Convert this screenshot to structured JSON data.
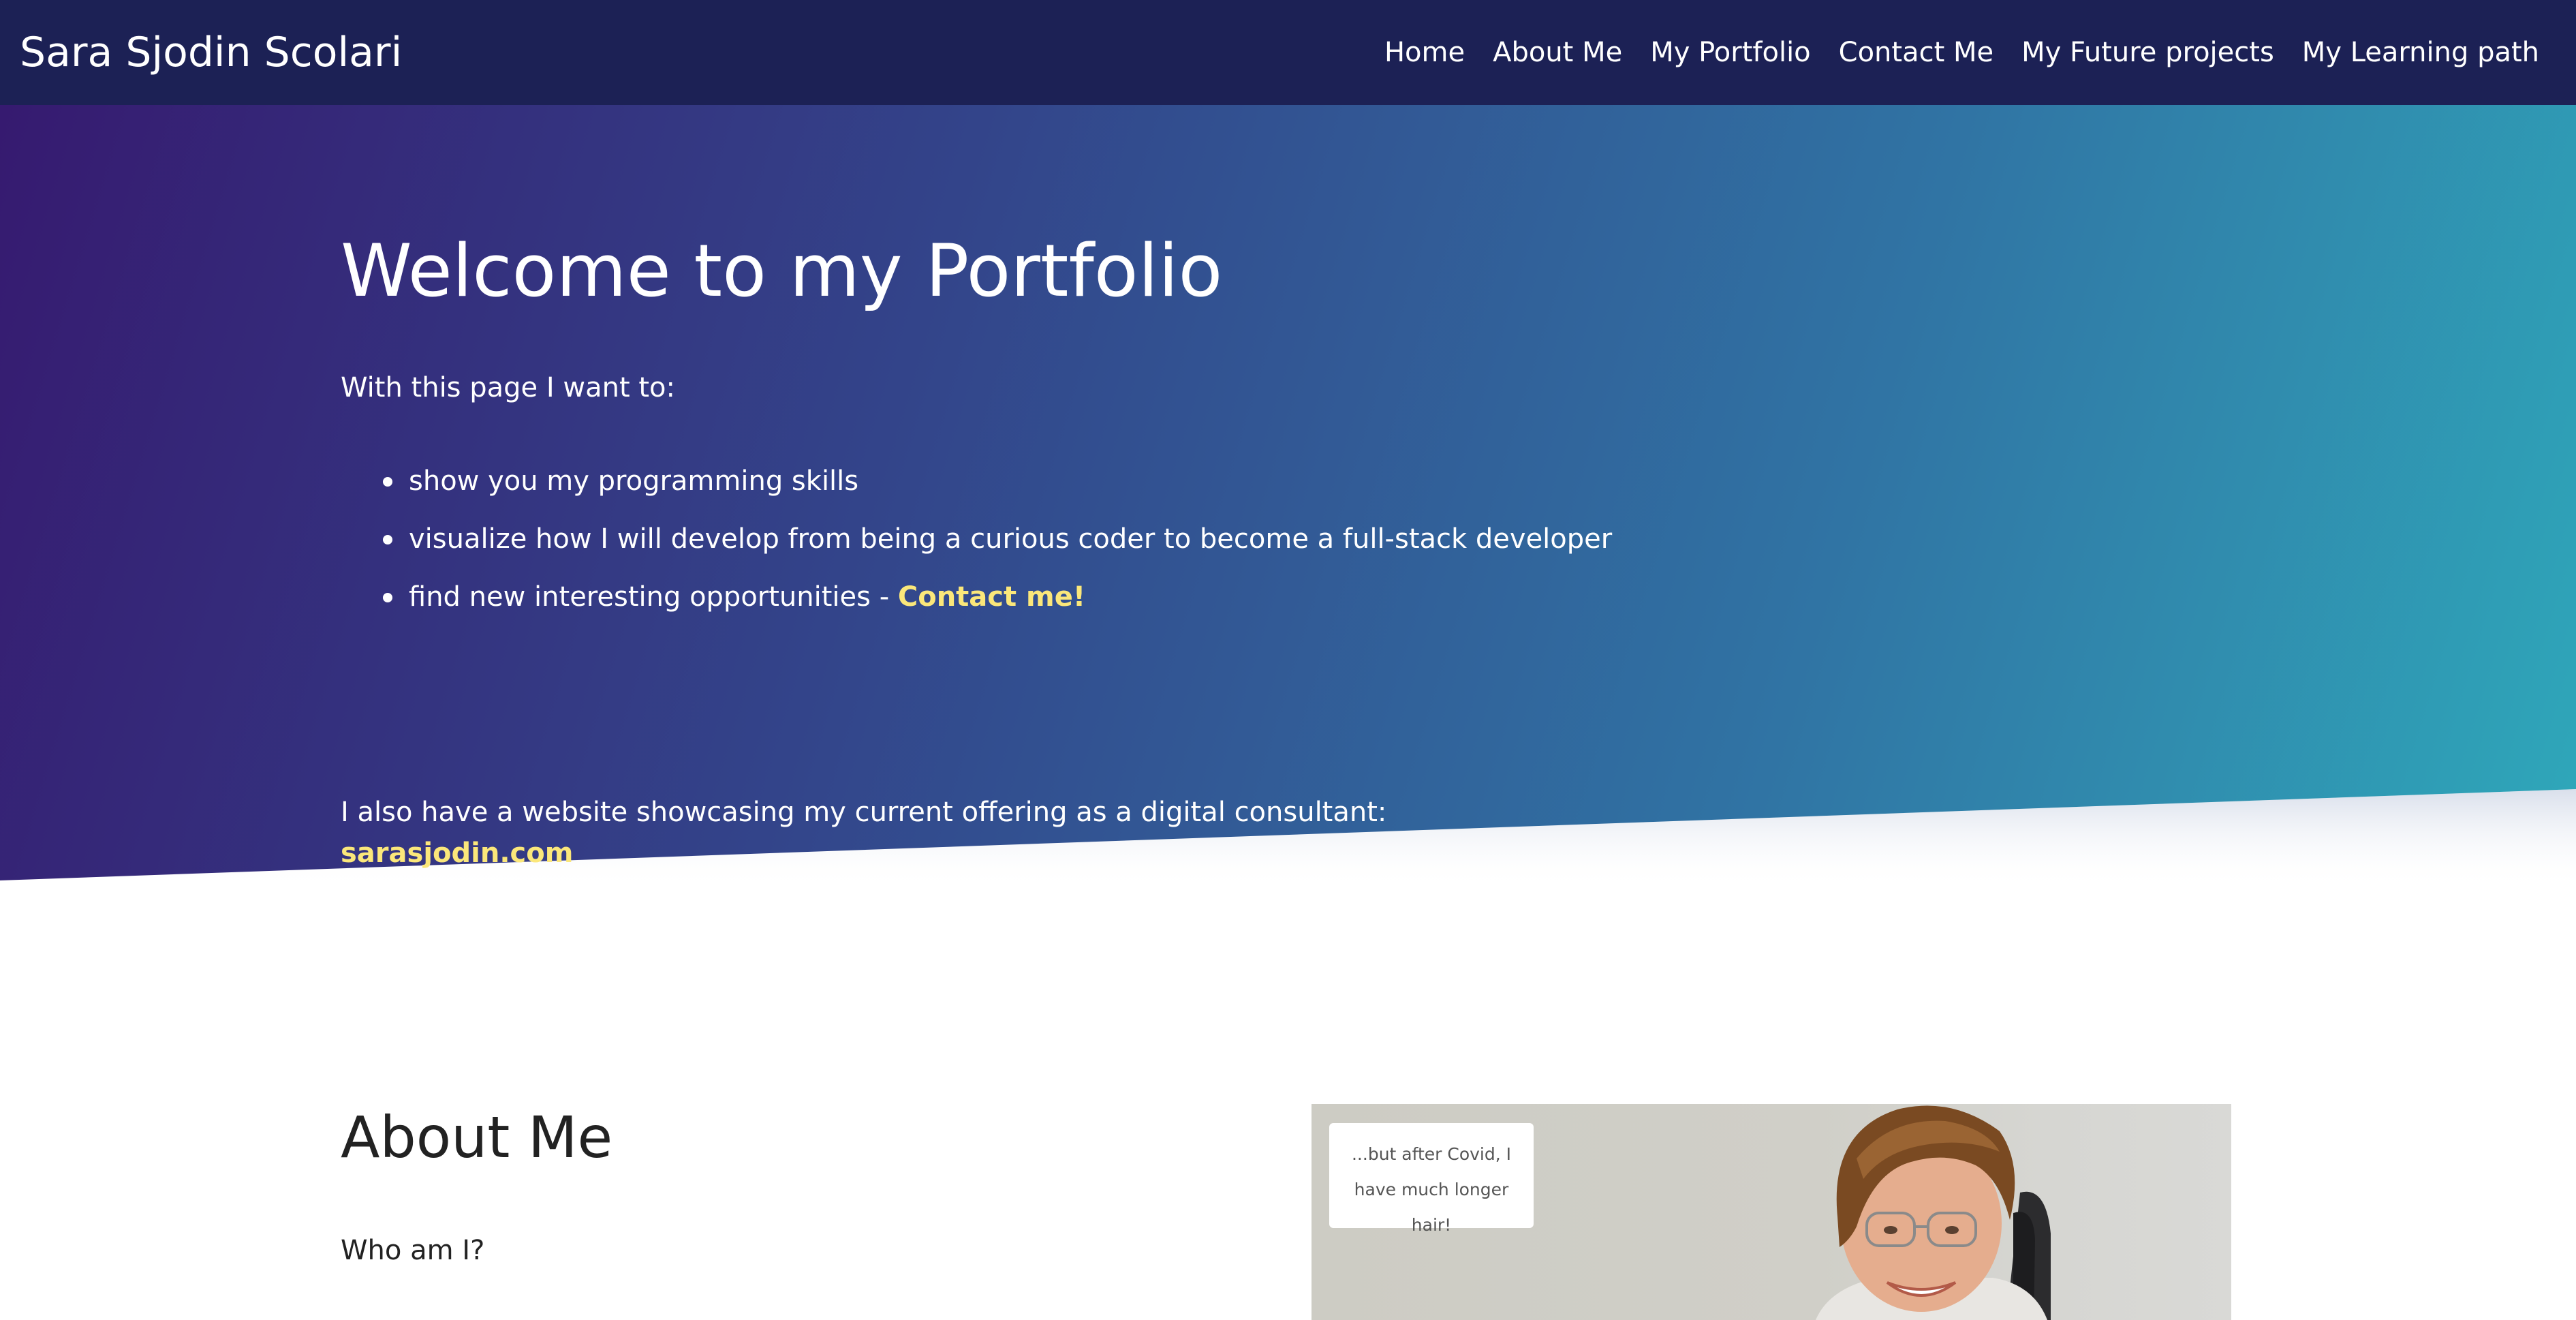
{
  "navbar": {
    "brand": "Sara Sjodin Scolari",
    "links": [
      "Home",
      "About Me",
      "My Portfolio",
      "Contact Me",
      "My Future projects",
      "My Learning path"
    ]
  },
  "hero": {
    "title": "Welcome to my Portfolio",
    "intro": "With this page I want to:",
    "bullets": [
      "show you my programming skills",
      "visualize how I will develop from being a curious coder to become a full-stack developer",
      "find new interesting opportunities - "
    ],
    "contact_link": "Contact me!",
    "outro": "I also have a website showcasing my current offering as a digital consultant:",
    "site_link": "sarasjodin.com"
  },
  "about": {
    "title": "About Me",
    "subtitle": "Who am I?",
    "photo_note": "...but after Covid, I have much longer hair!"
  },
  "colors": {
    "navbar": "#1c2155",
    "hero_gradient_start": "#361a70",
    "hero_gradient_end": "#2fa3b8",
    "link_highlight": "#fbe77a"
  }
}
